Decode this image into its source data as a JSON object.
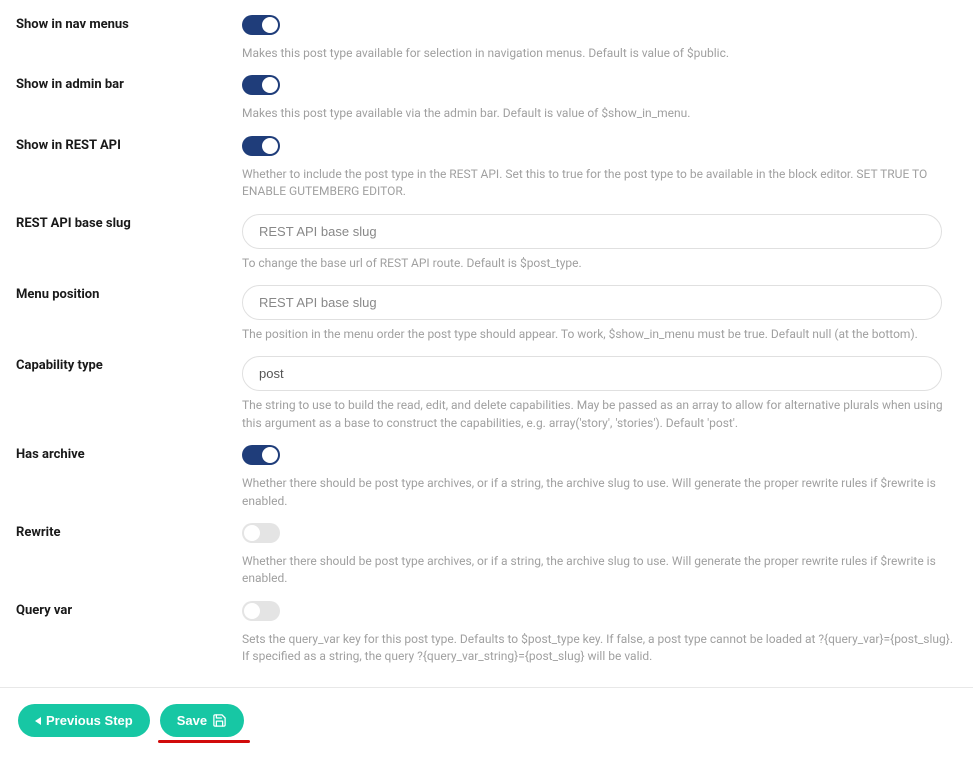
{
  "fields": {
    "show_nav": {
      "label": "Show in nav menus",
      "on": true,
      "help": "Makes this post type available for selection in navigation menus. Default is value of $public."
    },
    "show_admin": {
      "label": "Show in admin bar",
      "on": true,
      "help": "Makes this post type available via the admin bar. Default is value of $show_in_menu."
    },
    "show_rest": {
      "label": "Show in REST API",
      "on": true,
      "help": "Whether to include the post type in the REST API. Set this to true for the post type to be available in the block editor. SET TRUE TO ENABLE GUTEMBERG EDITOR."
    },
    "rest_slug": {
      "label": "REST API base slug",
      "placeholder": "REST API base slug",
      "value": "",
      "help": "To change the base url of REST API route. Default is $post_type."
    },
    "menu_pos": {
      "label": "Menu position",
      "placeholder": "REST API base slug",
      "value": "",
      "help": "The position in the menu order the post type should appear. To work, $show_in_menu must be true. Default null (at the bottom)."
    },
    "cap_type": {
      "label": "Capability type",
      "value": "post",
      "placeholder": "",
      "help": "The string to use to build the read, edit, and delete capabilities. May be passed as an array to allow for alternative plurals when using this argument as a base to construct the capabilities, e.g. array('story', 'stories'). Default 'post'."
    },
    "has_archive": {
      "label": "Has archive",
      "on": true,
      "help": "Whether there should be post type archives, or if a string, the archive slug to use. Will generate the proper rewrite rules if $rewrite is enabled."
    },
    "rewrite": {
      "label": "Rewrite",
      "on": false,
      "help": "Whether there should be post type archives, or if a string, the archive slug to use. Will generate the proper rewrite rules if $rewrite is enabled."
    },
    "query_var": {
      "label": "Query var",
      "on": false,
      "help": "Sets the query_var key for this post type. Defaults to $post_type key. If false, a post type cannot be loaded at ?{query_var}={post_slug}. If specified as a string, the query ?{query_var_string}={post_slug} will be valid."
    }
  },
  "footer": {
    "prev_label": "Previous Step",
    "save_label": "Save"
  }
}
